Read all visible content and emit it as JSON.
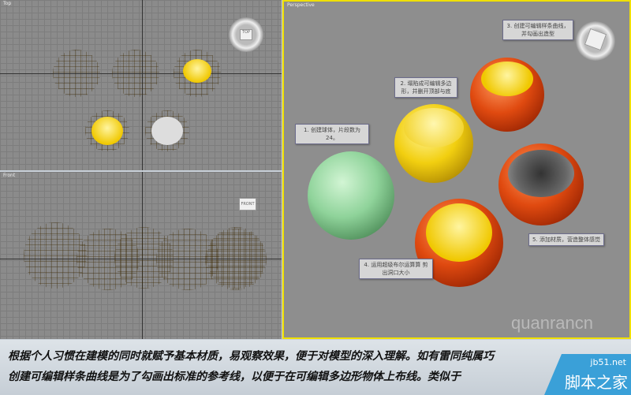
{
  "viewports": {
    "top": {
      "label": "Top",
      "cube": "TOP"
    },
    "front": {
      "label": "Front",
      "cube": "FRONT"
    },
    "perspective": {
      "label": "Perspective"
    }
  },
  "callouts": [
    {
      "line1": "1. 创建球体，片段数为24。",
      "line2": ""
    },
    {
      "line1": "2. 塌陷成可编辑多边",
      "line2": "形，并删开顶部与底"
    },
    {
      "line1": "3. 创建可编辑样条曲线，",
      "line2": "并勾画出造型"
    },
    {
      "line1": "4. 运用超级布尔运算算 剪",
      "line2": "出洞口大小"
    },
    {
      "line1": "5. 添加材质，营造整体感觉",
      "line2": ""
    }
  ],
  "watermark": "quanrancn",
  "caption": {
    "line1": "根据个人习惯在建模的同时就赋予基本材质，易观察效果，便于对模型的深入理解。如有雷同纯属巧",
    "line2": "创建可编辑样条曲线是为了勾画出标准的参考线，以便于在可编辑多边形物体上布线。类似于"
  },
  "logo": {
    "site": "jb51.net",
    "name": "脚本之家"
  },
  "colors": {
    "active_border": "#f0e000",
    "logo": "#3aa0d8"
  }
}
